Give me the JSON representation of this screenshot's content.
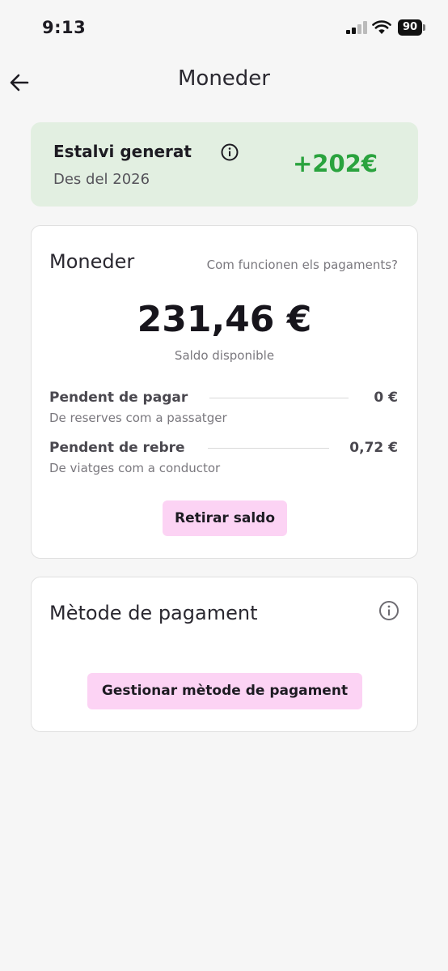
{
  "status_bar": {
    "time": "9:13",
    "battery": "90"
  },
  "header": {
    "title": "Moneder"
  },
  "savings": {
    "title": "Estalvi generat",
    "subtitle": "Des del 2026",
    "amount": "+202€"
  },
  "wallet": {
    "title": "Moneder",
    "how_link": "Com funcionen els pagaments?",
    "balance": "231,46 €",
    "balance_label": "Saldo disponible",
    "rows": [
      {
        "label": "Pendent de pagar",
        "sub": "De reserves com a passatger",
        "value": "0 €"
      },
      {
        "label": "Pendent de rebre",
        "sub": "De viatges com a conductor",
        "value": "0,72 €"
      }
    ],
    "withdraw_label": "Retirar saldo"
  },
  "payment": {
    "title": "Mètode de pagament",
    "manage_label": "Gestionar mètode de pagament"
  },
  "colors": {
    "accent_green": "#2aa33e",
    "savings_bg": "#e2efe1",
    "button_pink": "#fcd3f4"
  },
  "icons": [
    "back-arrow-icon",
    "info-icon",
    "signal-icon",
    "wifi-icon",
    "battery-icon"
  ]
}
